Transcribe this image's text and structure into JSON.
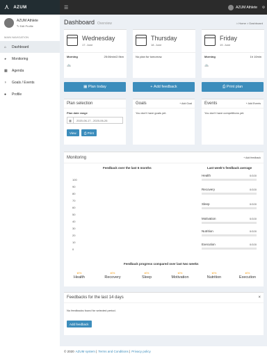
{
  "app": {
    "name": "AZUM"
  },
  "topbar": {
    "user_name": "AZUM Athlete"
  },
  "sidebar": {
    "user_name": "AZUM Athlete",
    "edit_profile": "Edit Profile",
    "nav_header": "MAIN NAVIGATION",
    "items": [
      {
        "label": "Dashboard",
        "icon": "home-icon",
        "active": true
      },
      {
        "label": "Monitoring",
        "icon": "chart-icon",
        "active": false
      },
      {
        "label": "Agenda",
        "icon": "calendar-icon",
        "active": false
      },
      {
        "label": "Goals / Events",
        "icon": "trophy-icon",
        "active": false
      },
      {
        "label": "Profile",
        "icon": "user-icon",
        "active": false
      }
    ]
  },
  "page": {
    "title": "Dashboard",
    "subtitle": "Overview",
    "breadcrumb_home": "Home",
    "breadcrumb_current": "Dashboard"
  },
  "days": [
    {
      "day": "Wednesday",
      "date": "17. June",
      "session": "Morning",
      "detail": "25:06min/2.9km",
      "sub_icon": "bike-icon"
    },
    {
      "day": "Thursday",
      "date": "18. June",
      "session": "",
      "detail": "No plan for tomorrow.",
      "sub_icon": ""
    },
    {
      "day": "Friday",
      "date": "19. June",
      "session": "Morning",
      "detail": "1h 10min",
      "sub_icon": "bike-icon"
    }
  ],
  "actions": {
    "plan_today": "Plan today",
    "add_feedback": "Add feedback",
    "print_plan": "Print plan"
  },
  "plan_selection": {
    "title": "Plan selection",
    "range_label": "Plan date range",
    "range_value": "2020-06-17 - 2020-06-26",
    "view_label": "View",
    "print_label": "Print"
  },
  "goals": {
    "title": "Goals",
    "add_label": "+ Add Goal",
    "empty": "You don't have goals yet."
  },
  "events": {
    "title": "Events",
    "add_label": "+ Add Events",
    "empty": "You don't have competitions yet."
  },
  "monitoring": {
    "title": "Monitoring",
    "add_label": "+ Add feedback",
    "chart_title": "Feedback over the last 6 months",
    "last_week_title": "Last week's feedback average",
    "progress_title": "Feedback progress compared over last two weeks",
    "y_ticks": [
      "100",
      "90",
      "80",
      "70",
      "60",
      "50",
      "40",
      "30",
      "20",
      "10",
      "0"
    ]
  },
  "last_week": [
    {
      "label": "Health",
      "value": "0/100"
    },
    {
      "label": "Recovery",
      "value": "0/100"
    },
    {
      "label": "Sleep",
      "value": "0/100"
    },
    {
      "label": "Motivation",
      "value": "0/100"
    },
    {
      "label": "Nutrition",
      "value": "0/100"
    },
    {
      "label": "Execution",
      "value": "0/100"
    }
  ],
  "progress": [
    {
      "label": "Health",
      "value": "▾0%"
    },
    {
      "label": "Recovery",
      "value": "▾0%"
    },
    {
      "label": "Sleep",
      "value": "▾0%"
    },
    {
      "label": "Motivation",
      "value": "▾0%"
    },
    {
      "label": "Nutrition",
      "value": "▾0%"
    },
    {
      "label": "Execution",
      "value": "▾0%"
    }
  ],
  "feedbacks": {
    "title": "Feedbacks for the last 14 days",
    "empty": "No feedbacks found for selected period.",
    "add_label": "Add feedback"
  },
  "footer": {
    "text": "© 2020",
    "link1": "AZUM system",
    "link2": "Terms and Conditions",
    "link3": "Privacy policy"
  },
  "colors": {
    "primary": "#3c8dbc",
    "dark": "#222d32",
    "warning": "#f39c12"
  }
}
